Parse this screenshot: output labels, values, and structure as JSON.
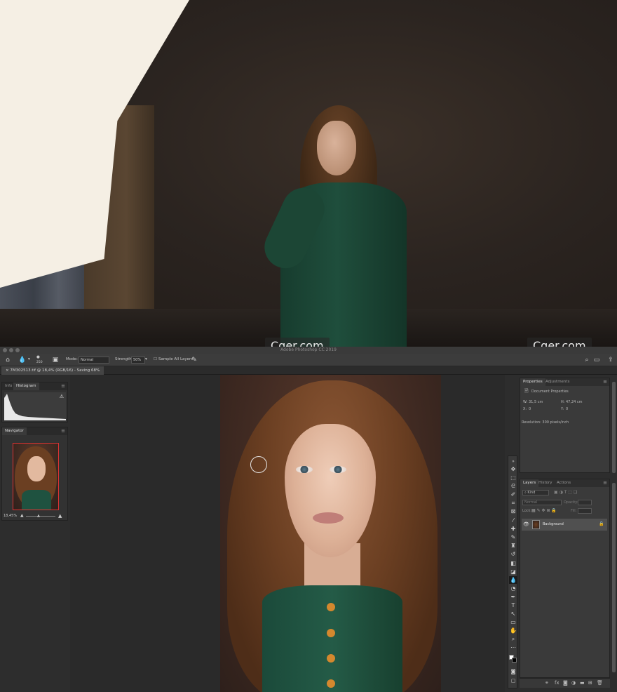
{
  "watermark": "Cger.com",
  "app": {
    "title": "Adobe Photoshop CC 2019"
  },
  "options_bar": {
    "brush_size": "250",
    "mode_label": "Mode:",
    "mode_value": "Normal",
    "strength_label": "Strength:",
    "strength_value": "50%",
    "sample_all_layers": "Sample All Layers"
  },
  "document_tab": {
    "label": "7M302513.tif @ 18,4% (RGB/16) - Saving 68%"
  },
  "left_panels": {
    "histogram_tabs": [
      "Info",
      "Histogram"
    ],
    "histogram_active": "Histogram",
    "navigator_tab": "Navigator",
    "navigator_zoom": "18,45%"
  },
  "properties_panel": {
    "tabs": [
      "Properties",
      "Adjustments"
    ],
    "section": "Document Properties",
    "w_label": "W:",
    "w_value": "31,5 cm",
    "h_label": "H:",
    "h_value": "47,24 cm",
    "x_label": "X:",
    "x_value": "0",
    "y_label": "Y:",
    "y_value": "0",
    "resolution": "Resolution: 300 pixels/inch"
  },
  "layers_panel": {
    "tabs": [
      "Layers",
      "History",
      "Actions"
    ],
    "search_placeholder": "Kind",
    "blend_mode": "Normal",
    "opacity_label": "Opacity:",
    "lock_label": "Lock:",
    "fill_label": "Fill:",
    "layer_name": "Background"
  },
  "colors": {
    "panel_bg": "#3a3a3a",
    "canvas_bg": "#2a2a2a",
    "dress_green": "#1f4e3c",
    "button_orange": "#d4882e",
    "nav_frame": "#dd3333"
  },
  "tools": [
    "move-icon",
    "marquee-icon",
    "lasso-icon",
    "quick-select-icon",
    "crop-icon",
    "frame-icon",
    "eyedropper-icon",
    "healing-icon",
    "brush-icon",
    "stamp-icon",
    "history-brush-icon",
    "eraser-icon",
    "gradient-icon",
    "blur-icon",
    "dodge-icon",
    "pen-icon",
    "type-icon",
    "path-select-icon",
    "rectangle-icon",
    "hand-icon",
    "zoom-icon",
    "more-icon"
  ]
}
